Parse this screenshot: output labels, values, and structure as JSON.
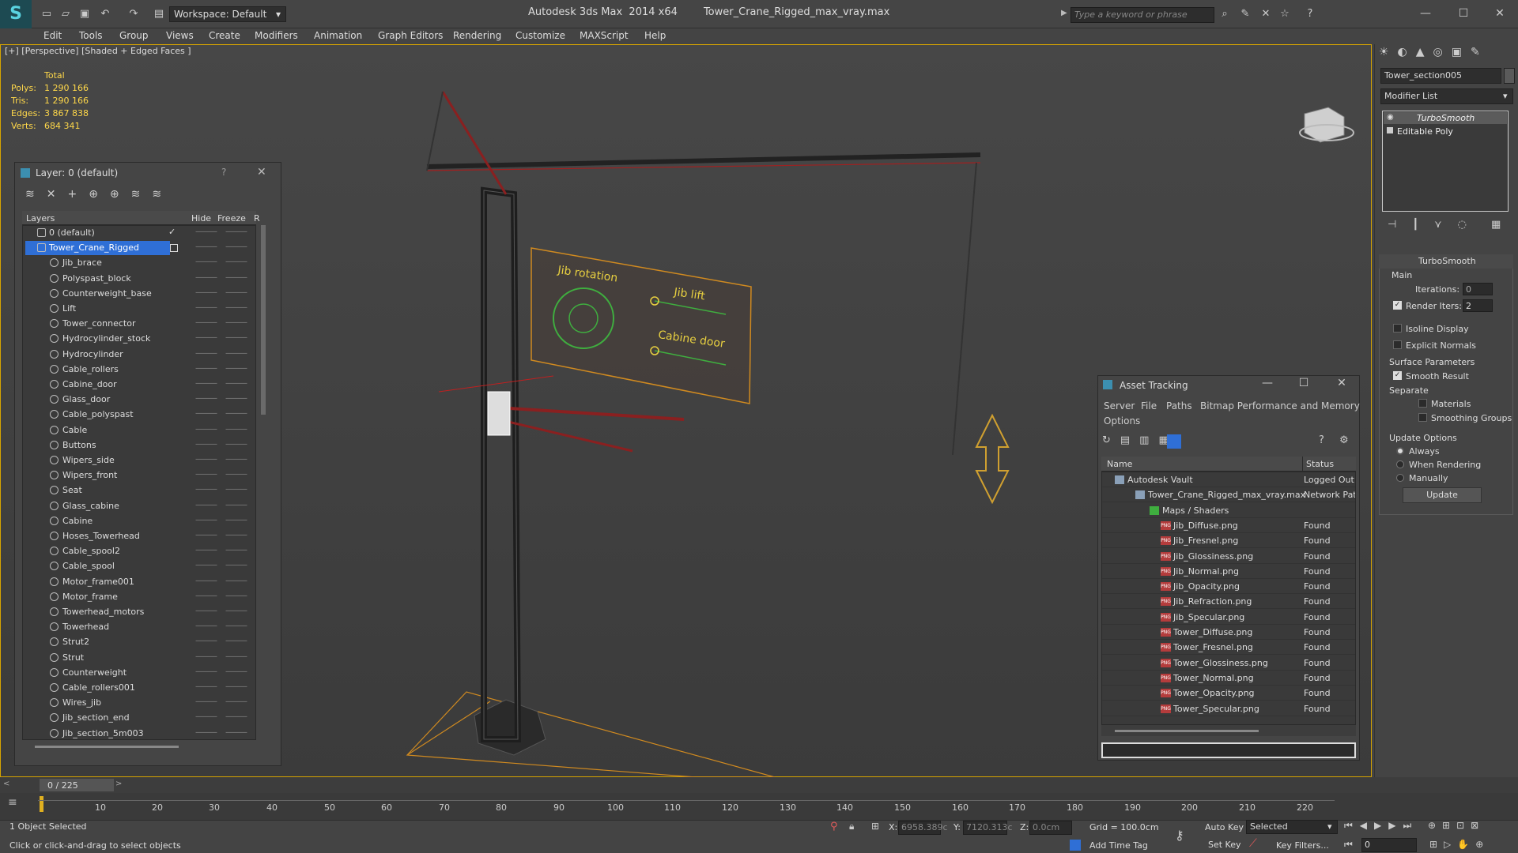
{
  "titlebar": {
    "workspace": "Workspace: Default",
    "app": "Autodesk 3ds Max  2014 x64",
    "file": "Tower_Crane_Rigged_max_vray.max",
    "search_placeholder": "Type a keyword or phrase"
  },
  "menu": [
    "Edit",
    "Tools",
    "Group",
    "Views",
    "Create",
    "Modifiers",
    "Animation",
    "Graph Editors",
    "Rendering",
    "Customize",
    "MAXScript",
    "Help"
  ],
  "viewport": {
    "label": "[+] [Perspective] [Shaded + Edged Faces ]",
    "stats_header": "Total",
    "stats": [
      {
        "label": "Polys:",
        "value": "1 290 166"
      },
      {
        "label": "Tris:",
        "value": "1 290 166"
      },
      {
        "label": "Edges:",
        "value": "3 867 838"
      },
      {
        "label": "Verts:",
        "value": "684 341"
      }
    ],
    "control_panel": {
      "jib_rotation": "Jib rotation",
      "jib_lift": "Jib lift",
      "cabine_door": "Cabine door"
    }
  },
  "layer_window": {
    "title": "Layer: 0 (default)",
    "help": "?",
    "col_layers": "Layers",
    "col_hide": "Hide",
    "col_freeze": "Freeze",
    "col_r": "R",
    "rows": [
      "0 (default)",
      "Tower_Crane_Rigged",
      "Jib_brace",
      "Polyspast_block",
      "Counterweight_base",
      "Lift",
      "Tower_connector",
      "Hydrocylinder_stock",
      "Hydrocylinder",
      "Cable_rollers",
      "Cabine_door",
      "Glass_door",
      "Cable_polyspast",
      "Cable",
      "Buttons",
      "Wipers_side",
      "Wipers_front",
      "Seat",
      "Glass_cabine",
      "Cabine",
      "Hoses_Towerhead",
      "Cable_spool2",
      "Cable_spool",
      "Motor_frame001",
      "Motor_frame",
      "Towerhead_motors",
      "Towerhead",
      "Strut2",
      "Strut",
      "Counterweight",
      "Cable_rollers001",
      "Wires_jib",
      "Jib_section_end",
      "Jib_section_5m003"
    ]
  },
  "asset_window": {
    "title": "Asset Tracking",
    "menu": [
      "Server",
      "File",
      "Paths",
      "Bitmap Performance and Memory",
      "Options"
    ],
    "col_name": "Name",
    "col_status": "Status",
    "vault": {
      "name": "Autodesk Vault",
      "status": "Logged Out"
    },
    "file": {
      "name": "Tower_Crane_Rigged_max_vray.max",
      "status": "Network Pat"
    },
    "maps": "Maps / Shaders",
    "files": [
      {
        "name": "Jib_Diffuse.png",
        "status": "Found"
      },
      {
        "name": "Jib_Fresnel.png",
        "status": "Found"
      },
      {
        "name": "Jib_Glossiness.png",
        "status": "Found"
      },
      {
        "name": "Jib_Normal.png",
        "status": "Found"
      },
      {
        "name": "Jib_Opacity.png",
        "status": "Found"
      },
      {
        "name": "Jib_Refraction.png",
        "status": "Found"
      },
      {
        "name": "Jib_Specular.png",
        "status": "Found"
      },
      {
        "name": "Tower_Diffuse.png",
        "status": "Found"
      },
      {
        "name": "Tower_Fresnel.png",
        "status": "Found"
      },
      {
        "name": "Tower_Glossiness.png",
        "status": "Found"
      },
      {
        "name": "Tower_Normal.png",
        "status": "Found"
      },
      {
        "name": "Tower_Opacity.png",
        "status": "Found"
      },
      {
        "name": "Tower_Specular.png",
        "status": "Found"
      }
    ]
  },
  "command_panel": {
    "object_name": "Tower_section005",
    "modifier_list": "Modifier List",
    "stack": [
      "TurboSmooth",
      "Editable Poly"
    ],
    "rollout_title": "TurboSmooth",
    "main_group": "Main",
    "iterations_label": "Iterations:",
    "iterations": "0",
    "render_iters_label": "Render Iters:",
    "render_iters": "2",
    "isoline": "Isoline Display",
    "explicit_normals": "Explicit Normals",
    "surface_params": "Surface Parameters",
    "smooth_result": "Smooth Result",
    "separate": "Separate",
    "materials": "Materials",
    "smoothing_groups": "Smoothing Groups",
    "update_options": "Update Options",
    "always": "Always",
    "when_rendering": "When Rendering",
    "manually": "Manually",
    "update_btn": "Update"
  },
  "timeline": {
    "frame": "0 / 225",
    "ticks": [
      "10",
      "20",
      "30",
      "40",
      "50",
      "60",
      "70",
      "80",
      "90",
      "100",
      "110",
      "120",
      "130",
      "140",
      "150",
      "160",
      "170",
      "180",
      "190",
      "200",
      "210",
      "220"
    ]
  },
  "status": {
    "selected": "1 Object Selected",
    "prompt": "Click or click-and-drag to select objects",
    "x_label": "X:",
    "x": "6958.389c",
    "y_label": "Y:",
    "y": "7120.313c",
    "z_label": "Z:",
    "z": "0.0cm",
    "grid": "Grid = 100.0cm",
    "add_time_tag": "Add Time Tag",
    "auto_key": "Auto Key",
    "auto_key_value": "Selected",
    "set_key": "Set Key",
    "key_filters": "Key Filters...",
    "frame_field": "0"
  },
  "colors": {
    "viewport_border": "#d6a400",
    "stats_text": "#ffd84a",
    "selection_blue": "#2f6fd6",
    "panel_green": "#3fae3f",
    "panel_label_yellow": "#e8d040",
    "crane_red": "#b02020"
  }
}
